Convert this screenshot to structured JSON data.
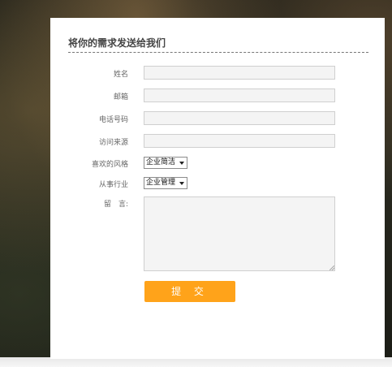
{
  "form": {
    "title": "将你的需求发送给我们",
    "name_label": "姓名",
    "email_label": "邮箱",
    "phone_label": "电话号码",
    "source_label": "访问来源",
    "style_label": "喜欢的风格",
    "style_value": "企业简洁",
    "industry_label": "从事行业",
    "industry_value": "企业管理",
    "message_label": "留　言:",
    "submit_label": "提 交"
  },
  "colors": {
    "accent": "#ffa31a",
    "input_bg": "#f4f4f4"
  }
}
